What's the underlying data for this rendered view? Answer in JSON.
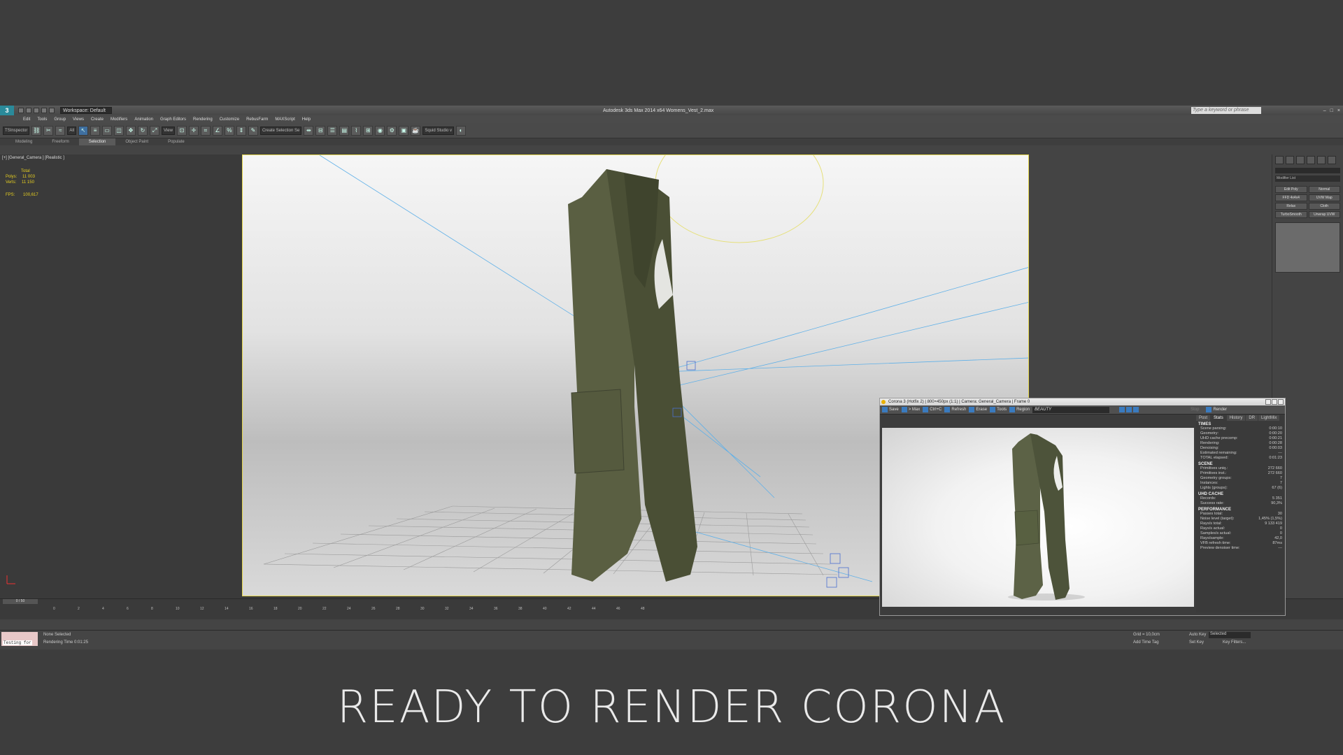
{
  "app": {
    "title": "Autodesk 3ds Max  2014 x64     Womens_Vest_2.max",
    "workspace": "Workspace: Default",
    "search_placeholder": "Type a keyword or phrase"
  },
  "menu": [
    "Edit",
    "Tools",
    "Group",
    "Views",
    "Create",
    "Modifiers",
    "Animation",
    "Graph Editors",
    "Rendering",
    "Customize",
    "RebusFarm",
    "MAXScript",
    "Help"
  ],
  "toolbar": {
    "tsinspector": "TSInspector",
    "filter": "All",
    "view": "View",
    "selection_set": "Create Selection Se",
    "squid": "Squid Studio v"
  },
  "ribbon": [
    "Modeling",
    "Freeform",
    "Selection",
    "Object Paint",
    "Populate"
  ],
  "viewport": {
    "label": "[+] [General_Camera ] [Realistic ]",
    "stats": {
      "total": "Total",
      "polys_label": "Polys:",
      "polys": "11 003",
      "verts_label": "Verts:",
      "verts": "11 150",
      "fps_label": "FPS:",
      "fps": "100,617"
    }
  },
  "command_panel": {
    "modifier_list": "Modifier List",
    "buttons": [
      "Edit Poly",
      "Normal",
      "FFD 4x4x4",
      "UVW Map",
      "Relax",
      "Cloth",
      "TurboSmooth",
      "Unwrap UVW"
    ]
  },
  "timeline": {
    "slider": "0 / 50",
    "ticks": [
      "0",
      "2",
      "4",
      "6",
      "8",
      "10",
      "12",
      "14",
      "16",
      "18",
      "20",
      "22",
      "24",
      "26",
      "28",
      "30",
      "32",
      "34",
      "36",
      "38",
      "40",
      "42",
      "44",
      "46",
      "48"
    ]
  },
  "status": {
    "testing": "Testing for",
    "none_selected": "None Selected",
    "render_time": "Rendering Time  0:01:25",
    "grid": "Grid = 10,0cm",
    "add_time_tag": "Add Time Tag",
    "auto_key": "Auto Key",
    "selected": "Selected",
    "set_key": "Set Key",
    "key_filters": "Key Filters..."
  },
  "corona": {
    "title": "Corona 3 (Hotfix 2) | 800×450px (1:1) | Camera: General_Camera | Frame 0",
    "tools": [
      "Save",
      "> Max",
      "Ctrl+C",
      "Refresh",
      "Erase",
      "Tools",
      "Region"
    ],
    "beauty": "BEAUTY",
    "stop": "Stop",
    "render": "Render",
    "tabs": [
      "Post",
      "Stats",
      "History",
      "DR",
      "LightMix"
    ],
    "sections": [
      {
        "title": "TIMES",
        "rows": [
          [
            "Scene parsing:",
            "0:00:10"
          ],
          [
            "Geometry:",
            "0:00:20"
          ],
          [
            "UHD cache precomp:",
            "0:00:21"
          ],
          [
            "Rendering:",
            "0:00:28"
          ],
          [
            "Denoising:",
            "0:00:03"
          ],
          [
            "Estimated remaining:",
            "---"
          ],
          [
            "TOTAL elapsed:",
            "0:01:23"
          ]
        ]
      },
      {
        "title": "SCENE",
        "rows": [
          [
            "Primitives uniq.:",
            "272 660"
          ],
          [
            "Primitives inst.:",
            "272 660"
          ],
          [
            "Geometry groups:",
            "7"
          ],
          [
            "Instances:",
            "7"
          ],
          [
            "Lights (groups):",
            "67 (6)"
          ]
        ]
      },
      {
        "title": "UHD CACHE",
        "rows": [
          [
            "Records:",
            "5 351"
          ],
          [
            "Success rate:",
            "90,3%"
          ]
        ]
      },
      {
        "title": "PERFORMANCE",
        "rows": [
          [
            "Passes total:",
            "30"
          ],
          [
            "Noise level (target):",
            "1,45% (1,5%)"
          ],
          [
            "Rays/s total:",
            "9 133 419"
          ],
          [
            "Rays/s actual:",
            "0"
          ],
          [
            "Samples/s actual:",
            "0"
          ],
          [
            "Rays/sample:",
            "42,0"
          ],
          [
            "VFB refresh time:",
            "87ms"
          ],
          [
            "Preview denoiser time:",
            "---"
          ]
        ]
      }
    ]
  },
  "caption": "READY TO RENDER  CORONA",
  "colors": {
    "vest": "#4e5338",
    "accent": "#3a7bbf",
    "viewport_border": "#e6d850"
  }
}
